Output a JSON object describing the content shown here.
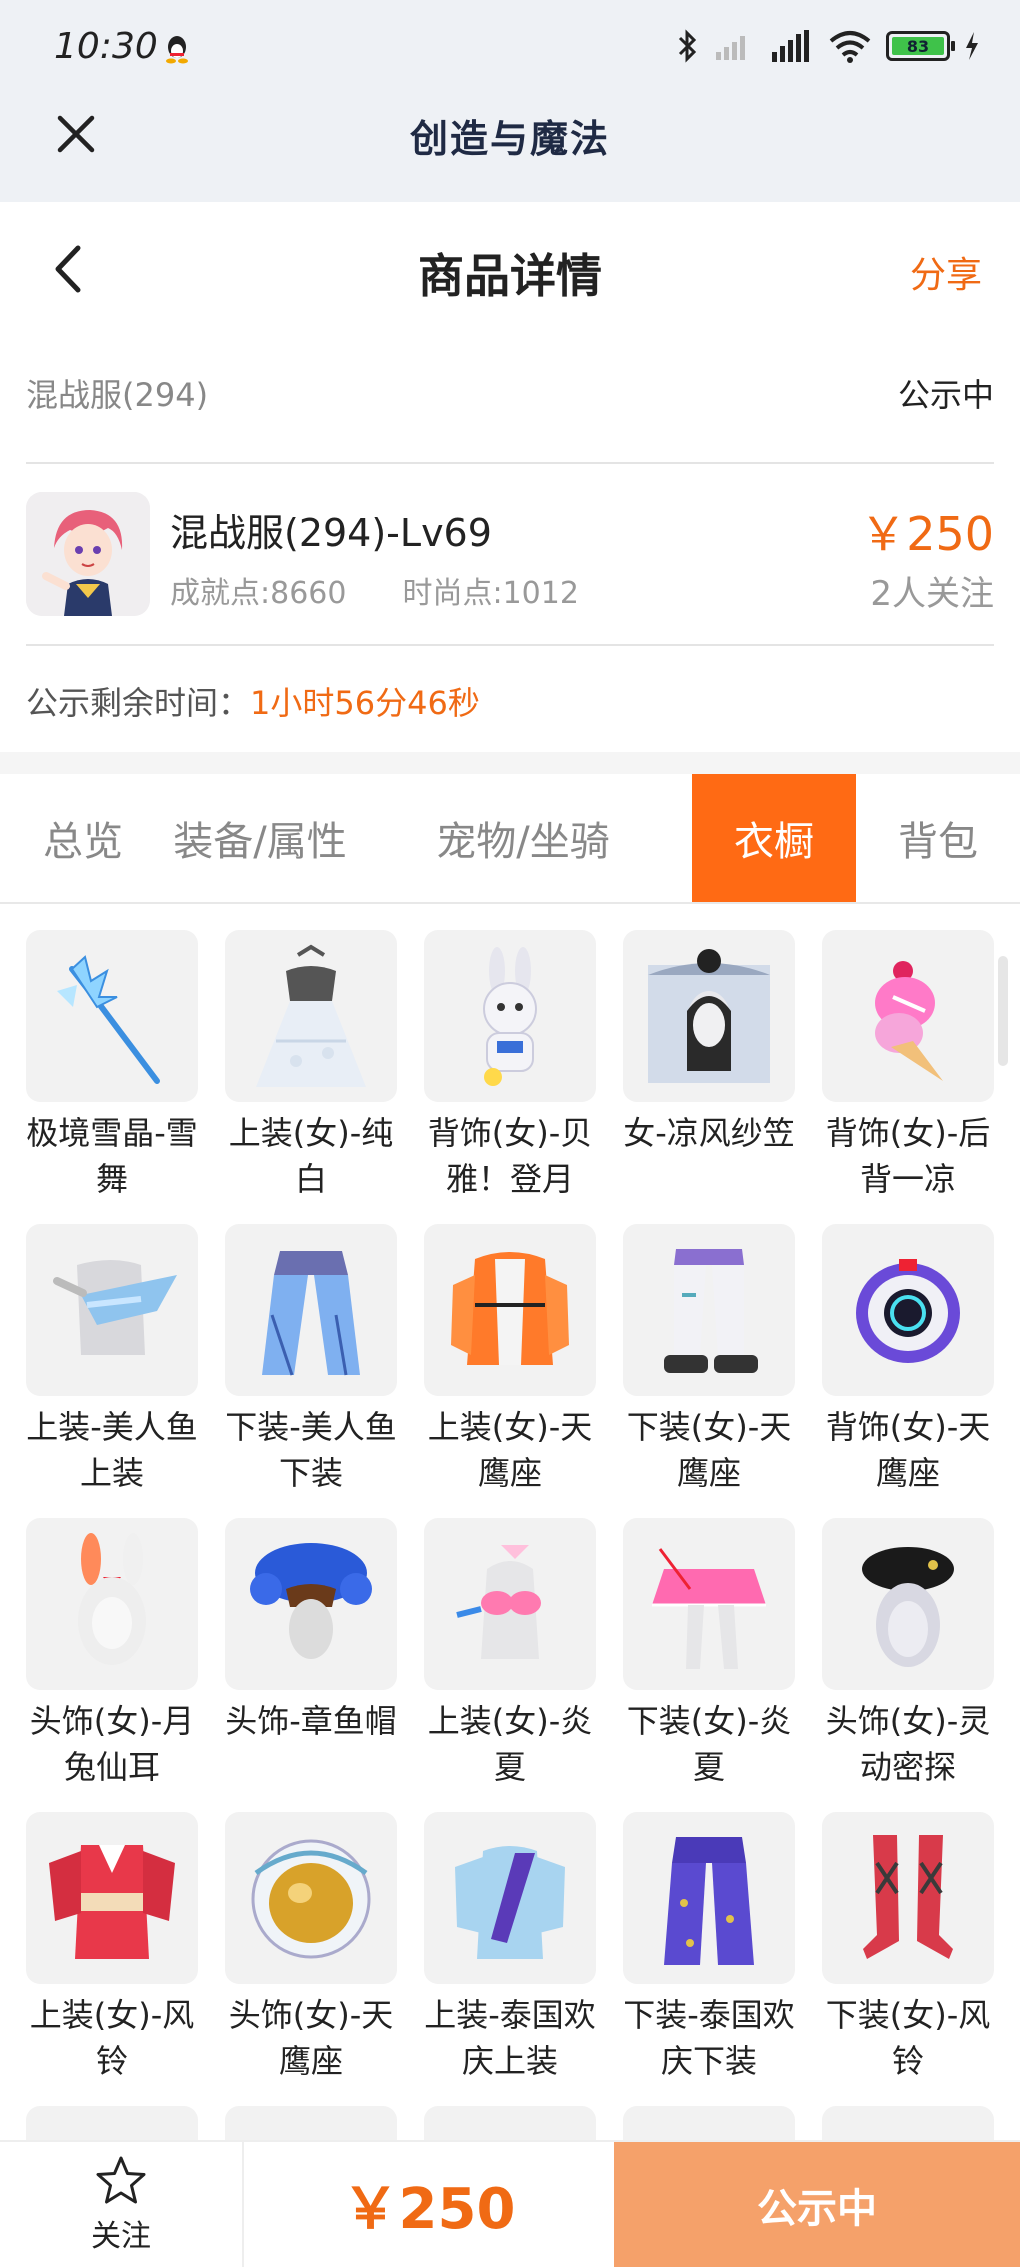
{
  "status_bar": {
    "time": "10:30",
    "battery": "83"
  },
  "app": {
    "title": "创造与魔法"
  },
  "header": {
    "title": "商品详情",
    "share": "分享"
  },
  "server": {
    "name": "混战服(294)",
    "status": "公示中"
  },
  "product": {
    "name": "混战服(294)-Lv69",
    "achievement": "成就点:8660",
    "fashion": "时尚点:1012",
    "price": "￥250",
    "followers": "2人关注"
  },
  "timer": {
    "label": "公示剩余时间：",
    "value": "1小时56分46秒"
  },
  "tabs": [
    {
      "label": "总览"
    },
    {
      "label": "装备/属性"
    },
    {
      "label": "宠物/坐骑"
    },
    {
      "label": "衣橱"
    },
    {
      "label": "背包"
    }
  ],
  "active_tab": "衣橱",
  "wardrobe": [
    {
      "name": "极境雪晶-雪舞",
      "icon": "ice-crystal-wand-icon"
    },
    {
      "name": "上装(女)-纯白",
      "icon": "white-dress-icon"
    },
    {
      "name": "背饰(女)-贝雅！登月",
      "icon": "rabbit-astronaut-icon"
    },
    {
      "name": "女-凉风纱笠",
      "icon": "veil-hat-icon"
    },
    {
      "name": "背饰(女)-后背一凉",
      "icon": "ice-cream-icon"
    },
    {
      "name": "上装-美人鱼上装",
      "icon": "mermaid-top-icon"
    },
    {
      "name": "下装-美人鱼下装",
      "icon": "mermaid-pants-icon"
    },
    {
      "name": "上装(女)-天鹰座",
      "icon": "aquila-jacket-icon"
    },
    {
      "name": "下装(女)-天鹰座",
      "icon": "aquila-pants-icon"
    },
    {
      "name": "背饰(女)-天鹰座",
      "icon": "aquila-backpack-icon"
    },
    {
      "name": "头饰(女)-月兔仙耳",
      "icon": "bunny-ears-icon"
    },
    {
      "name": "头饰-章鱼帽",
      "icon": "octopus-hat-icon"
    },
    {
      "name": "上装(女)-炎夏",
      "icon": "bikini-top-icon"
    },
    {
      "name": "下装(女)-炎夏",
      "icon": "pink-skirt-icon"
    },
    {
      "name": "头饰(女)-灵动密探",
      "icon": "beret-icon"
    },
    {
      "name": "上装(女)-风铃",
      "icon": "kimono-icon"
    },
    {
      "name": "头饰(女)-天鹰座",
      "icon": "helmet-icon"
    },
    {
      "name": "上装-泰国欢庆上装",
      "icon": "thai-top-icon"
    },
    {
      "name": "下装-泰国欢庆下装",
      "icon": "thai-pants-icon"
    },
    {
      "name": "下装(女)-风铃",
      "icon": "boots-icon"
    }
  ],
  "bottom_bar": {
    "follow": "关注",
    "price": "￥250",
    "action": "公示中"
  },
  "colors": {
    "accent": "#ff6a14",
    "price": "#f06a14",
    "action_button": "#f5a16a"
  }
}
